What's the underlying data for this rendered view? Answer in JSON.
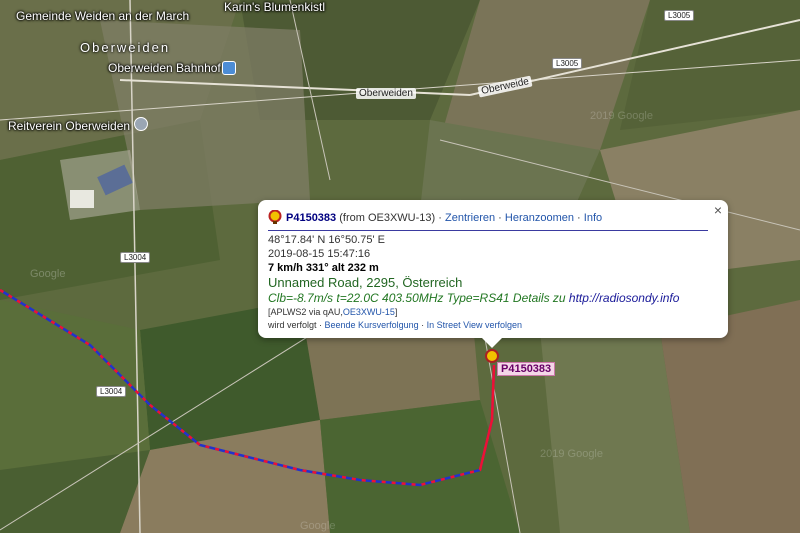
{
  "map": {
    "place_labels": [
      "Gemeinde Weiden an der March",
      "Oberweiden",
      "Oberweiden Bahnhof",
      "Reitverein Oberweiden",
      "Karin's Blumenkistl"
    ],
    "road_labels": [
      "Oberweiden",
      "Oberweide",
      "L3005",
      "L3004"
    ],
    "watermarks": [
      "Google",
      "2019 Google",
      "2019 Google",
      "Google"
    ]
  },
  "popup": {
    "callsign": "P4150383",
    "from": "(from OE3XWU-13)",
    "links": [
      "Zentrieren",
      "Heranzoomen",
      "Info"
    ],
    "coords": "48°17.84' N 16°50.75' E",
    "datetime": "2019-08-15 15:47:16",
    "speed_line": "7 km/h 331° alt 232 m",
    "address": "Unnamed Road, 2295, Österreich",
    "comment": "Clb=-8.7m/s t=22.0C 403.50MHz Type=RS41 Details zu ",
    "comment_url": "http://radiosondy.info",
    "path_prefix": "[APLWS2 via qAU,",
    "path_link": "OE3XWU-15",
    "path_suffix": "]",
    "footer_text": "wird verfolgt ·",
    "footer_links": [
      "Beende Kursverfolgung",
      "In Street View verfolgen"
    ],
    "close_symbol": "×"
  },
  "marker": {
    "label": "P4150383"
  },
  "colors": {
    "track_blue": "#2233cc",
    "track_red": "#ee1133"
  }
}
